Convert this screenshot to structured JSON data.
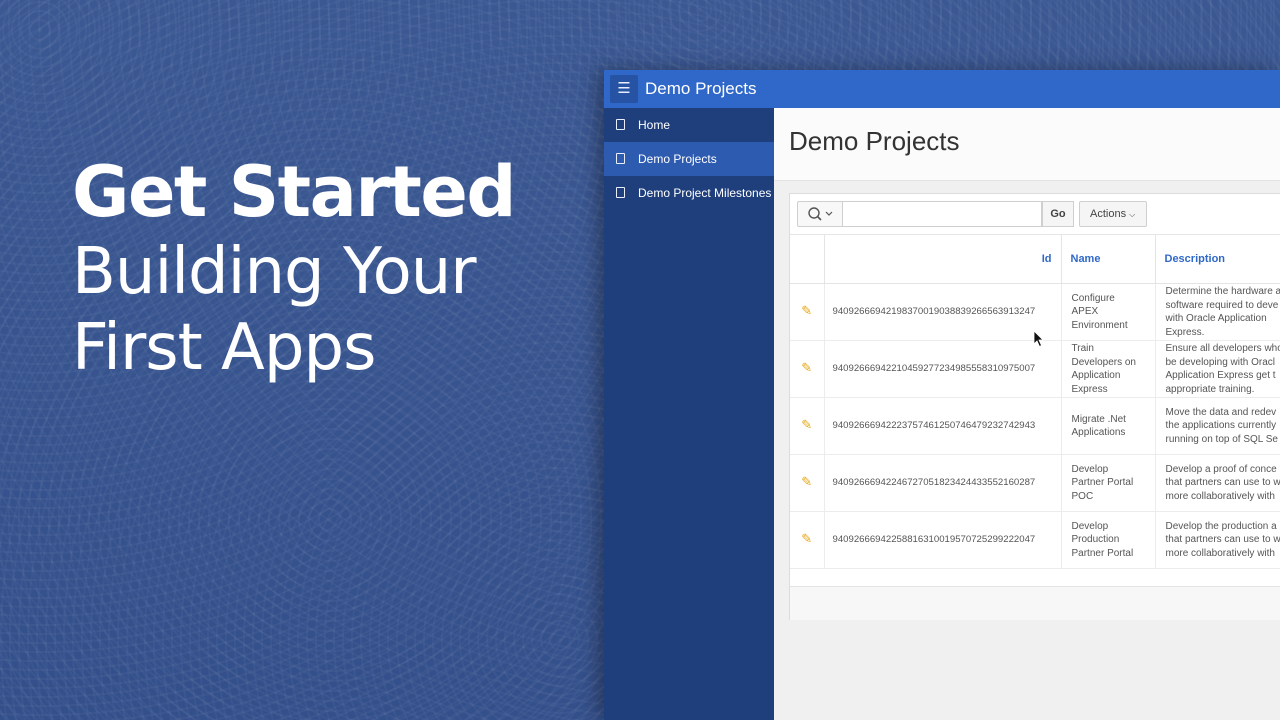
{
  "hero": {
    "title": "Get Started",
    "subtitle_line1": "Building Your",
    "subtitle_line2": "First Apps"
  },
  "app": {
    "title": "Demo Projects",
    "menu_icon": "hamburger-icon",
    "sidebar": {
      "items": [
        {
          "label": "Home",
          "icon": "page-icon",
          "active": false
        },
        {
          "label": "Demo Projects",
          "icon": "page-icon",
          "active": true
        },
        {
          "label": "Demo Project Milestones",
          "icon": "page-icon",
          "active": false
        }
      ]
    },
    "page_title": "Demo Projects",
    "toolbar": {
      "search_icon": "search-icon",
      "search_value": "",
      "go_label": "Go",
      "actions_label": "Actions"
    },
    "table": {
      "columns": [
        "Id",
        "Name",
        "Description"
      ],
      "rows": [
        {
          "id": "94092666942198370019038839266563913247",
          "name": [
            "Configure",
            "APEX",
            "Environment"
          ],
          "description": [
            "Determine the hardware a",
            "software required to deve",
            "with Oracle Application",
            "Express."
          ]
        },
        {
          "id": "94092666942210459277234985558310975007",
          "name": [
            "Train",
            "Developers on",
            "Application",
            "Express"
          ],
          "description": [
            "Ensure all developers who",
            "be developing with Oracl",
            "Application Express get t",
            "appropriate training."
          ]
        },
        {
          "id": "94092666942223757461250746479232742943",
          "name": [
            "Migrate .Net",
            "Applications"
          ],
          "description": [
            "Move the data and redev",
            "the applications currently",
            "running on top of SQL Se"
          ]
        },
        {
          "id": "94092666942246727051823424433552160287",
          "name": [
            "Develop",
            "Partner Portal",
            "POC"
          ],
          "description": [
            "Develop a proof of conce",
            "that partners can use to w",
            "more collaboratively with"
          ]
        },
        {
          "id": "94092666942258816310019570725299222047",
          "name": [
            "Develop",
            "Production",
            "Partner Portal"
          ],
          "description": [
            "Develop the production a",
            "that partners can use to w",
            "more collaboratively with"
          ]
        }
      ]
    }
  },
  "colors": {
    "background": "#3a5590",
    "topbar": "#2f68c8",
    "sidebar": "#1f3f7c",
    "sidebar_active": "#2c5bb0",
    "link": "#2f68c8",
    "pencil": "#e6a817"
  }
}
